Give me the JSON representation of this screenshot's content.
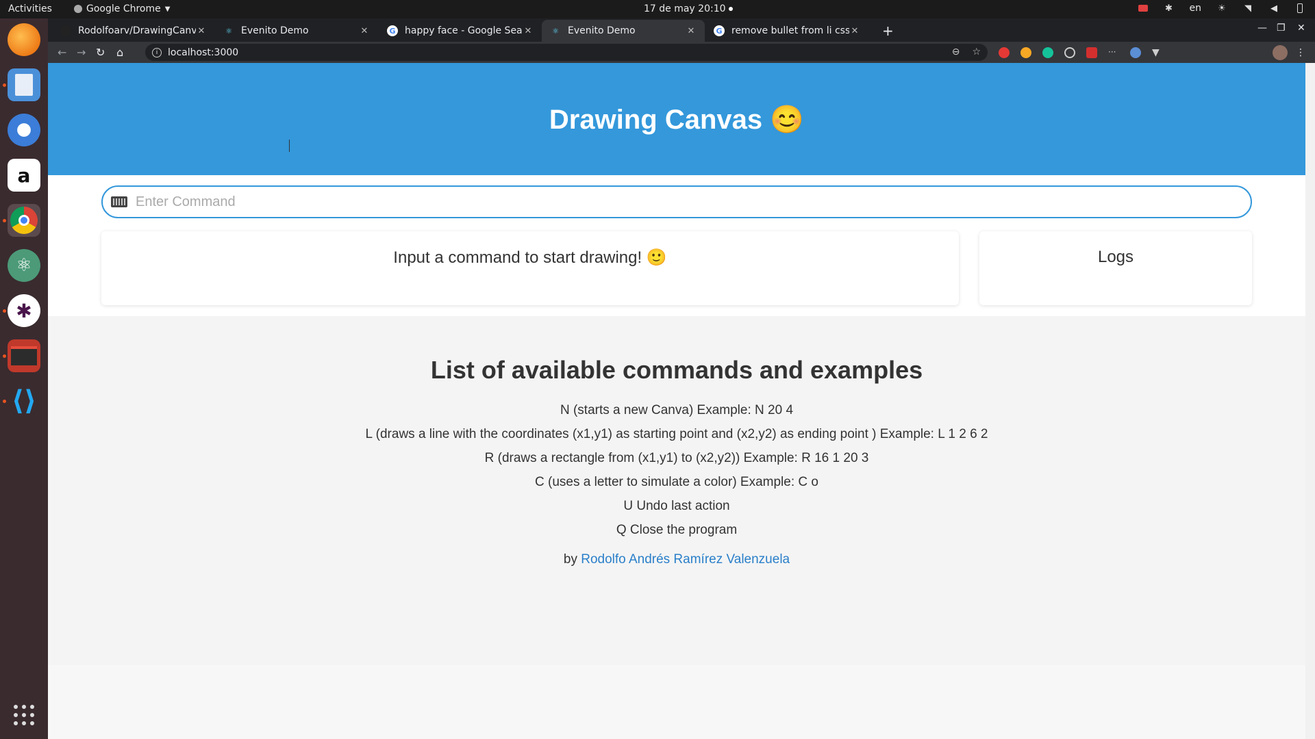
{
  "system": {
    "activities": "Activities",
    "app_name": "Google Chrome",
    "clock": "17 de may  20:10",
    "lang": "en"
  },
  "browser": {
    "tabs": [
      {
        "title": "Rodolfoarv/DrawingCanv",
        "active": false
      },
      {
        "title": "Evenito Demo",
        "active": false
      },
      {
        "title": "happy face - Google Searc",
        "active": false
      },
      {
        "title": "Evenito Demo",
        "active": true
      },
      {
        "title": "remove bullet from li css -",
        "active": false
      }
    ],
    "url": "localhost:3000"
  },
  "page": {
    "title": "Drawing Canvas 😊",
    "command_placeholder": "Enter Command",
    "canvas_message": "Input a command to start drawing! 🙂",
    "logs_title": "Logs",
    "commands_heading": "List of available commands and examples",
    "commands": [
      "N (starts a new Canva) Example: N 20 4",
      "L (draws a line with the coordinates (x1,y1) as starting point and (x2,y2) as ending point ) Example: L 1 2 6 2",
      "R (draws a rectangle from (x1,y1) to (x2,y2)) Example: R 16 1 20 3",
      "C (uses a letter to simulate a color) Example: C o",
      "U Undo last action",
      "Q Close the program"
    ],
    "byline_prefix": "by",
    "author": "Rodolfo Andrés Ramírez Valenzuela"
  },
  "colors": {
    "header": "#3498db",
    "link": "#2a7fc9"
  }
}
